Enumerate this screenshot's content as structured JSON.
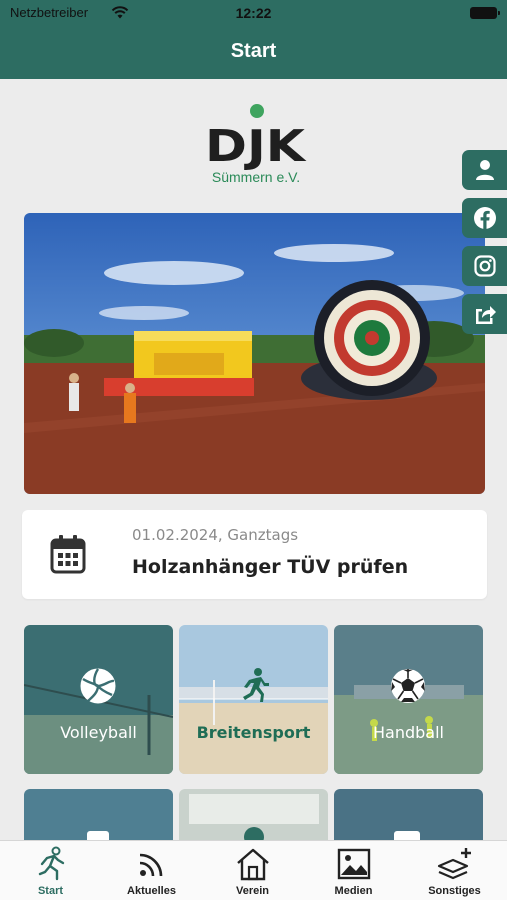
{
  "status_bar": {
    "carrier": "Netzbetreiber",
    "time": "12:22"
  },
  "nav": {
    "title": "Start"
  },
  "logo": {
    "text": "DJK",
    "subtitle": "Sümmern e.V."
  },
  "social_buttons": [
    "user-icon",
    "facebook-icon",
    "instagram-icon",
    "share-icon"
  ],
  "event": {
    "date": "01.02.2024, Ganztags",
    "title": "Holzanhänger TÜV prüfen"
  },
  "tiles": [
    {
      "label": "Volleyball",
      "icon": "volleyball-icon"
    },
    {
      "label": "Breitensport",
      "icon": "runner-icon"
    },
    {
      "label": "Handball",
      "icon": "soccer-ball-icon"
    }
  ],
  "tabs": [
    {
      "label": "Start",
      "icon": "runner-icon",
      "active": true
    },
    {
      "label": "Aktuelles",
      "icon": "feed-icon",
      "active": false
    },
    {
      "label": "Verein",
      "icon": "home-icon",
      "active": false
    },
    {
      "label": "Medien",
      "icon": "image-icon",
      "active": false
    },
    {
      "label": "Sonstiges",
      "icon": "layers-plus-icon",
      "active": false
    }
  ],
  "colors": {
    "brand": "#2d6d62",
    "background": "#ececec",
    "logo_green": "#2a8a58",
    "text_dark": "#222222",
    "text_muted": "#8a8a8a"
  }
}
